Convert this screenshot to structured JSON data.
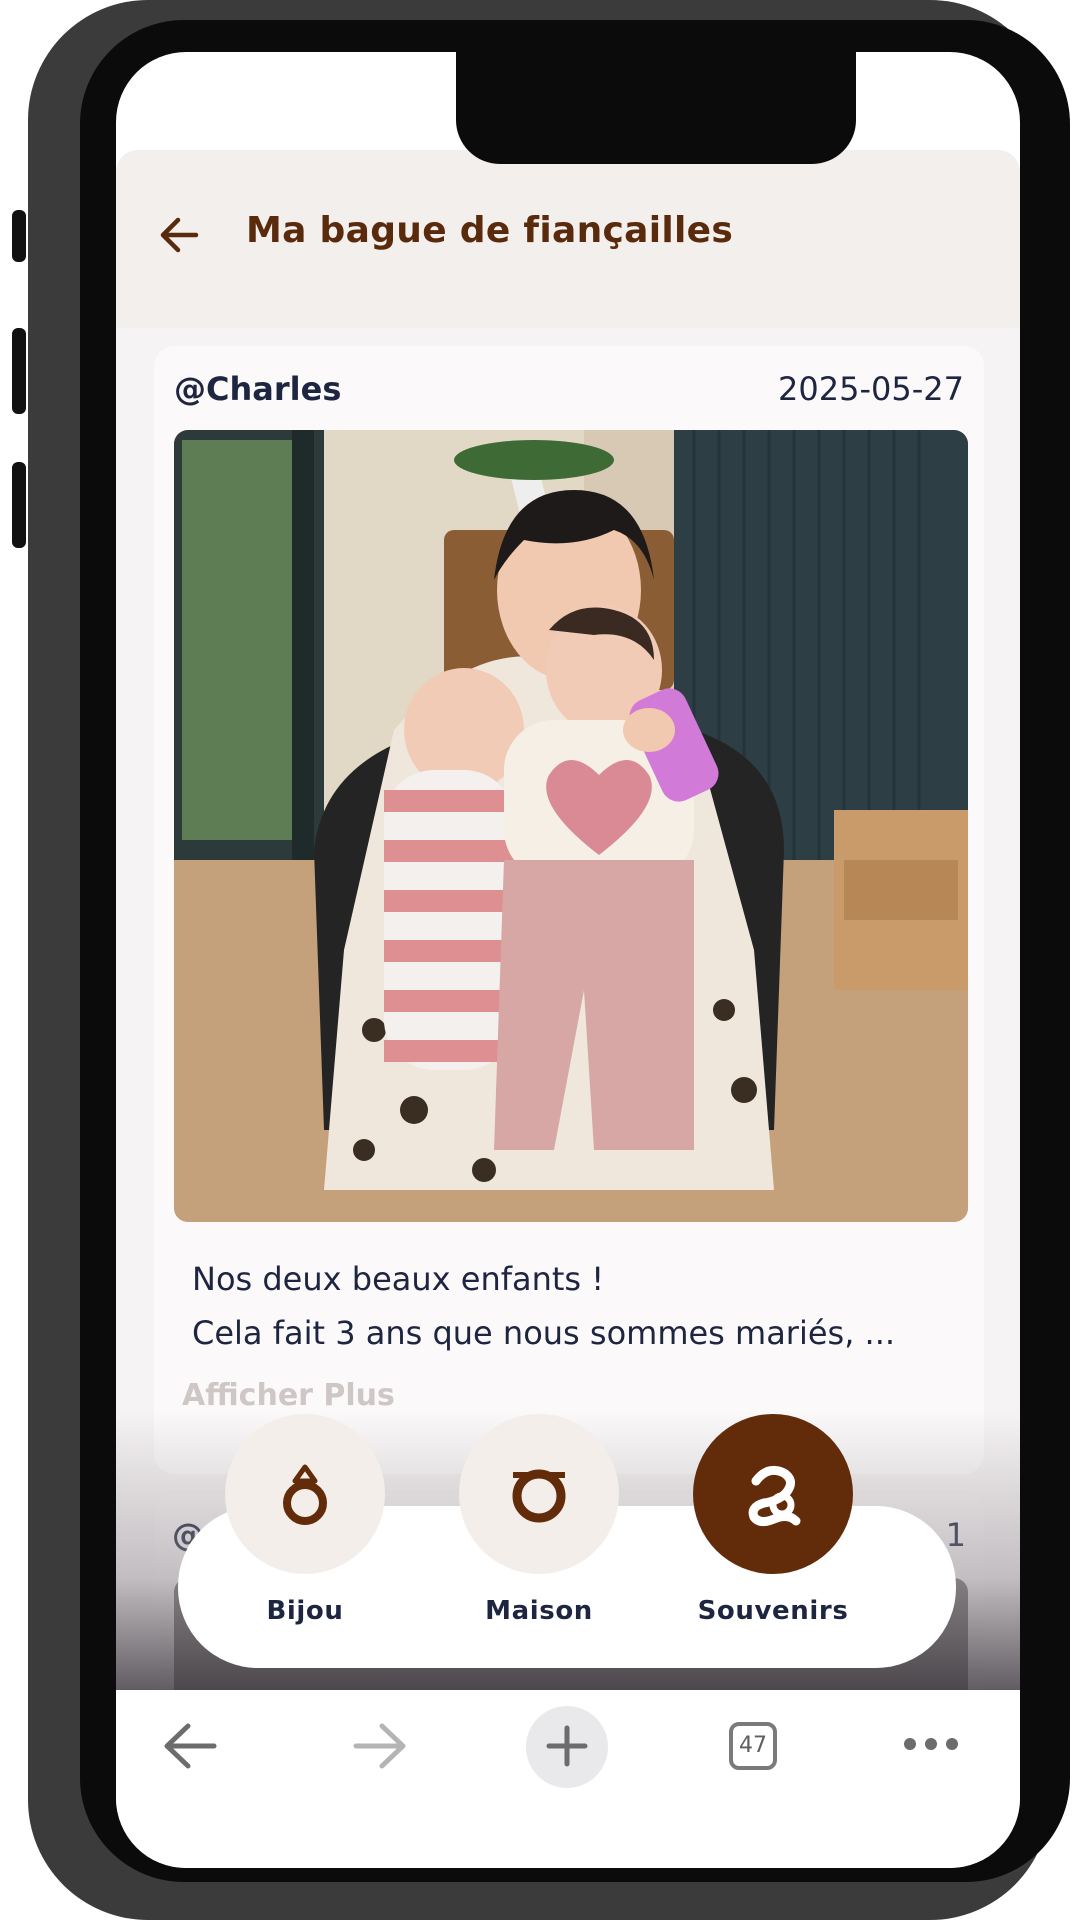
{
  "header": {
    "title": "Ma bague de fiançailles"
  },
  "post": {
    "author": "@Charles",
    "date": "2025-05-27",
    "text_line1": "Nos deux beaux enfants !",
    "text_line2": "Cela fait 3 ans que nous sommes mariés, ...",
    "show_more": "Afficher Plus",
    "image_description_icon": "photo-of-family"
  },
  "next_post": {
    "author_partial": "@",
    "date_partial": "1"
  },
  "category_nav": {
    "items": [
      {
        "label": "Bijou",
        "icon": "ring-icon",
        "active": false
      },
      {
        "label": "Maison",
        "icon": "house-letter-icon",
        "active": false
      },
      {
        "label": "Souvenirs",
        "icon": "memories-letter-icon",
        "active": true
      }
    ]
  },
  "browser_toolbar": {
    "tab_count": "47"
  },
  "colors": {
    "brand_brown": "#622c0b",
    "title_brown": "#5a2a0c",
    "text_navy": "#1d2540",
    "header_bg": "#f3efed",
    "circle_bg": "#f3eeea"
  }
}
